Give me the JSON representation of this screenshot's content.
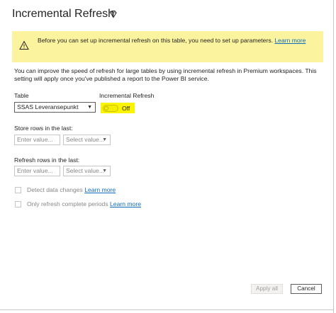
{
  "dialog": {
    "title": "Incremental Refresh",
    "title_icon": "diamond-icon",
    "banner": {
      "icon": "warning-icon",
      "text": "Before you can set up incremental refresh on this table, you need to set up parameters.",
      "link": "Learn more",
      "color": "#fbf39d"
    },
    "description_line1": "You can improve the speed of refresh for large tables by using incremental refresh in Premium workspaces. This",
    "description_line2": "setting will apply once you've published a report to the Power BI service.",
    "table_label": "Table",
    "table_value": "SSAS Leveransepunkt",
    "incremental_label": "Incremental Refresh",
    "toggle_state": "Off",
    "store_label": "Store rows in the last:",
    "store_value_placeholder": "Enter value...",
    "store_unit_placeholder": "Select value...",
    "refresh_label": "Refresh rows in the last:",
    "refresh_value_placeholder": "Enter value...",
    "refresh_unit_placeholder": "Select value...",
    "detect_label": "Detect data changes",
    "detect_link": "Learn more",
    "complete_label": "Only refresh complete periods",
    "complete_link": "Learn more",
    "apply_label": "Apply all",
    "cancel_label": "Cancel",
    "highlight_color": "#fbf300"
  }
}
